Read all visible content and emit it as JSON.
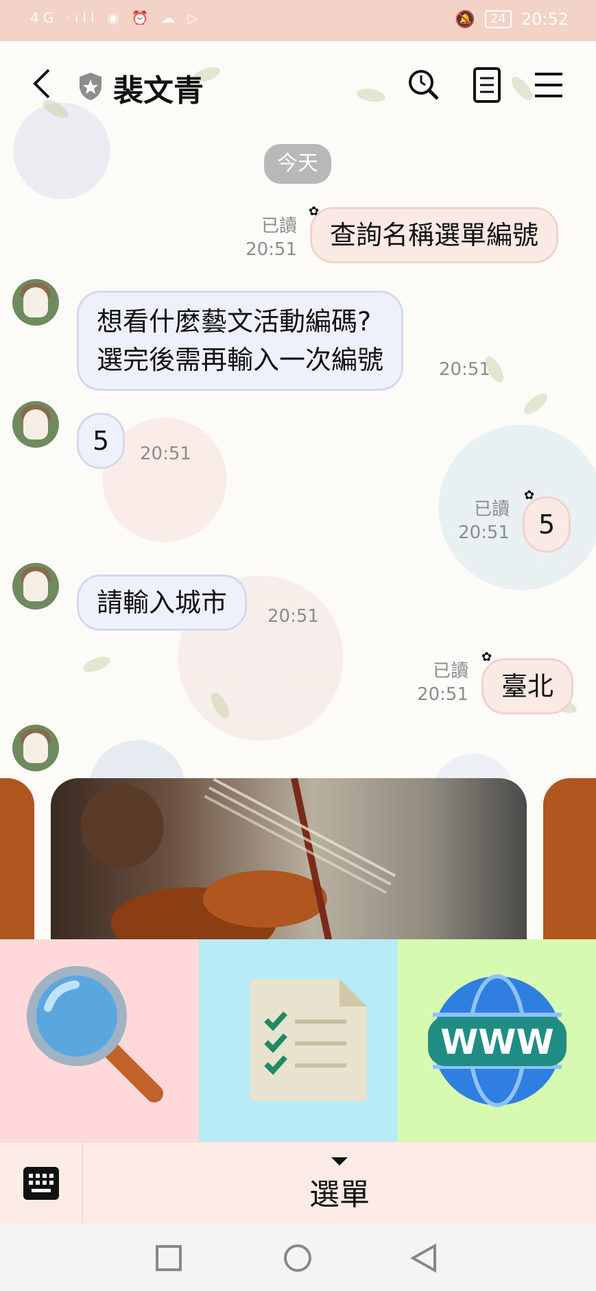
{
  "status_bar": {
    "left_indicators": "4G ·ıll  ◉  ⏰  ☁  ▷",
    "battery": "24",
    "time": "20:52"
  },
  "header": {
    "title": "裴文青",
    "back_icon": "chevron-left-icon",
    "search_icon": "search-icon",
    "notes_icon": "notes-icon",
    "menu_icon": "hamburger-menu-icon"
  },
  "chat": {
    "date_chip": "今天",
    "messages": [
      {
        "dir": "out",
        "text": "查詢名稱選單編號",
        "read": "已讀",
        "time": "20:51"
      },
      {
        "dir": "in",
        "lines": [
          "想看什麼藝文活動編碼?",
          "選完後需再輸入一次編號"
        ],
        "time": "20:51"
      },
      {
        "dir": "in",
        "text": "5",
        "time": "20:51"
      },
      {
        "dir": "out",
        "text": "5",
        "read": "已讀",
        "time": "20:51"
      },
      {
        "dir": "in",
        "text": "請輸入城市",
        "time": "20:51"
      },
      {
        "dir": "out",
        "text": "臺北",
        "read": "已讀",
        "time": "20:51"
      }
    ]
  },
  "rich_menu": {
    "items": [
      {
        "icon": "magnifier-icon",
        "bg": "#ffd9da"
      },
      {
        "icon": "checklist-document-icon",
        "bg": "#b6ebf7"
      },
      {
        "icon": "www-globe-icon",
        "bg": "#d6fbb0"
      }
    ]
  },
  "bottom_bar": {
    "menu_label": "選單",
    "keyboard_icon": "keyboard-icon"
  },
  "colors": {
    "status_bar": "#f3d2c8",
    "outgoing_bubble": "#fbe9e4",
    "incoming_bubble": "#eef1fb",
    "bottom_bar": "#fcebe6"
  }
}
